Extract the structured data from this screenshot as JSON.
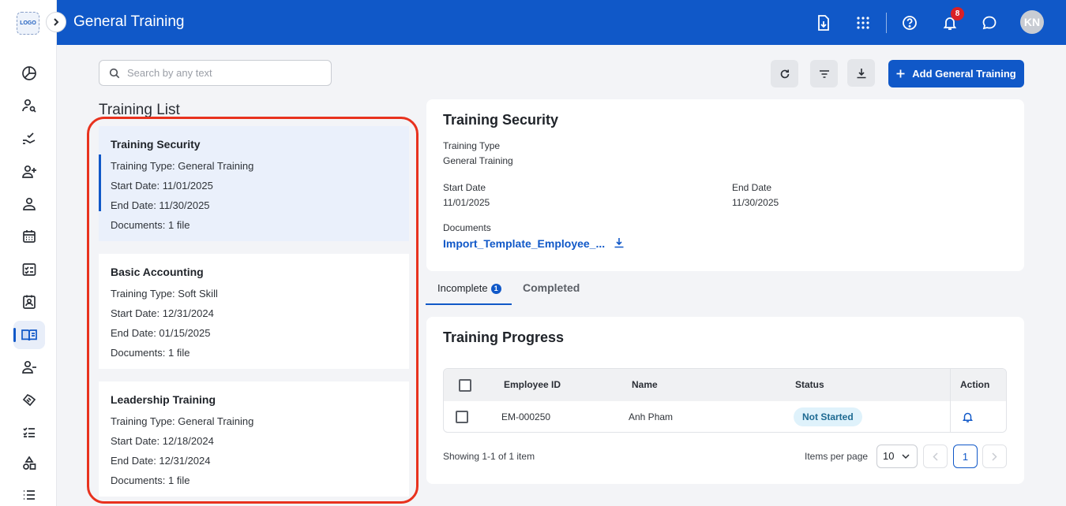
{
  "app": {
    "logo_text": "LOGO",
    "page_title": "General Training",
    "avatar_initials": "KN",
    "notification_count": "8"
  },
  "colors": {
    "brand": "#1058c8",
    "highlight": "#e8321e",
    "badge": "#d92026",
    "status_not_started": "#dff2fb"
  },
  "sidebar": {
    "items": [
      {
        "icon": "pie-chart-icon"
      },
      {
        "icon": "person-search-icon"
      },
      {
        "icon": "hand-check-icon"
      },
      {
        "icon": "person-add-icon"
      },
      {
        "icon": "person-icon"
      },
      {
        "icon": "calendar-icon"
      },
      {
        "icon": "checklist-box-icon"
      },
      {
        "icon": "contact-badge-icon"
      },
      {
        "icon": "book-icon",
        "active": true
      },
      {
        "icon": "person-remove-icon"
      },
      {
        "icon": "handshake-icon"
      },
      {
        "icon": "task-list-icon"
      },
      {
        "icon": "shapes-icon"
      },
      {
        "icon": "list-icon"
      }
    ]
  },
  "toolbar": {
    "search_placeholder": "Search by any text",
    "add_label": "Add General Training"
  },
  "training_list": {
    "heading": "Training List",
    "items": [
      {
        "title": "Training Security",
        "type": "Training Type: General Training",
        "start": "Start Date: 11/01/2025",
        "end": "End Date: 11/30/2025",
        "docs": "Documents: 1 file"
      },
      {
        "title": "Basic Accounting",
        "type": "Training Type: Soft Skill",
        "start": "Start Date: 12/31/2024",
        "end": "End Date: 01/15/2025",
        "docs": "Documents: 1 file"
      },
      {
        "title": "Leadership Training",
        "type": "Training Type: General Training",
        "start": "Start Date: 12/18/2024",
        "end": "End Date: 12/31/2024",
        "docs": "Documents: 1 file"
      }
    ]
  },
  "detail": {
    "title": "Training Security",
    "type_label": "Training Type",
    "type_value": "General Training",
    "start_label": "Start Date",
    "start_value": "11/01/2025",
    "end_label": "End Date",
    "end_value": "11/30/2025",
    "docs_label": "Documents",
    "doc_name": "Import_Template_Employee_..."
  },
  "tabs": {
    "incomplete_label": "Incomplete",
    "incomplete_count": "1",
    "completed_label": "Completed"
  },
  "progress": {
    "title": "Training Progress",
    "columns": {
      "id": "Employee ID",
      "name": "Name",
      "status": "Status",
      "action": "Action"
    },
    "rows": [
      {
        "id": "EM-000250",
        "name": "Anh Pham",
        "status": "Not Started"
      }
    ],
    "showing": "Showing 1-1 of 1 item",
    "ipp_label": "Items per page",
    "ipp_value": "10",
    "page": "1"
  }
}
